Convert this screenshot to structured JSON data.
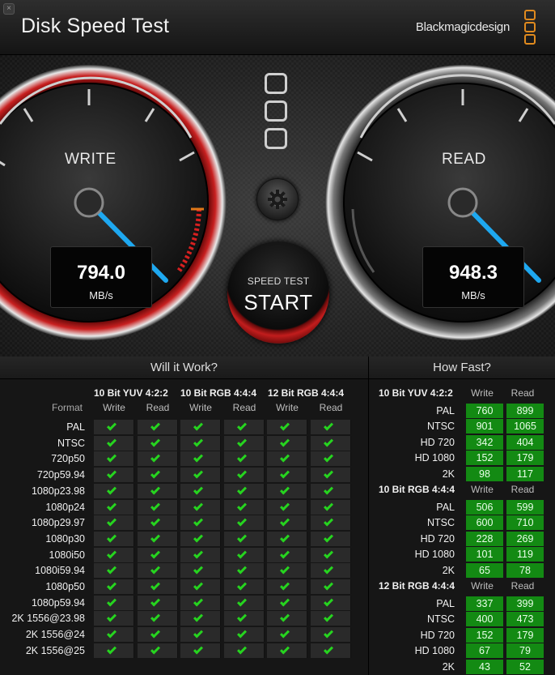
{
  "window": {
    "title": "Disk Speed Test",
    "brand": "Blackmagicdesign",
    "close_glyph": "×"
  },
  "gauges": {
    "write": {
      "label": "WRITE",
      "value": "794.0",
      "unit": "MB/s"
    },
    "read": {
      "label": "READ",
      "value": "948.3",
      "unit": "MB/s"
    }
  },
  "controls": {
    "settings_icon": "gear-icon",
    "start_small": "SPEED TEST",
    "start_big": "START"
  },
  "colors": {
    "accent": "#e08a1e",
    "write_ring": "#c21d1d",
    "needle": "#1ea8f0",
    "check": "#26d41f",
    "speed_cell": "#138a13"
  },
  "will_it_work": {
    "title": "Will it Work?",
    "format_header": "Format",
    "groups": [
      "10 Bit YUV 4:2:2",
      "10 Bit RGB 4:4:4",
      "12 Bit RGB 4:4:4"
    ],
    "sub_headers": [
      "Write",
      "Read",
      "Write",
      "Read",
      "Write",
      "Read"
    ],
    "rows": [
      {
        "format": "PAL",
        "checks": [
          true,
          true,
          true,
          true,
          true,
          true
        ]
      },
      {
        "format": "NTSC",
        "checks": [
          true,
          true,
          true,
          true,
          true,
          true
        ]
      },
      {
        "format": "720p50",
        "checks": [
          true,
          true,
          true,
          true,
          true,
          true
        ]
      },
      {
        "format": "720p59.94",
        "checks": [
          true,
          true,
          true,
          true,
          true,
          true
        ]
      },
      {
        "format": "1080p23.98",
        "checks": [
          true,
          true,
          true,
          true,
          true,
          true
        ]
      },
      {
        "format": "1080p24",
        "checks": [
          true,
          true,
          true,
          true,
          true,
          true
        ]
      },
      {
        "format": "1080p29.97",
        "checks": [
          true,
          true,
          true,
          true,
          true,
          true
        ]
      },
      {
        "format": "1080p30",
        "checks": [
          true,
          true,
          true,
          true,
          true,
          true
        ]
      },
      {
        "format": "1080i50",
        "checks": [
          true,
          true,
          true,
          true,
          true,
          true
        ]
      },
      {
        "format": "1080i59.94",
        "checks": [
          true,
          true,
          true,
          true,
          true,
          true
        ]
      },
      {
        "format": "1080p50",
        "checks": [
          true,
          true,
          true,
          true,
          true,
          true
        ]
      },
      {
        "format": "1080p59.94",
        "checks": [
          true,
          true,
          true,
          true,
          true,
          true
        ]
      },
      {
        "format": "2K 1556@23.98",
        "checks": [
          true,
          true,
          true,
          true,
          true,
          true
        ]
      },
      {
        "format": "2K 1556@24",
        "checks": [
          true,
          true,
          true,
          true,
          true,
          true
        ]
      },
      {
        "format": "2K 1556@25",
        "checks": [
          true,
          true,
          true,
          true,
          true,
          true
        ]
      }
    ]
  },
  "how_fast": {
    "title": "How Fast?",
    "groups": [
      {
        "name": "10 Bit YUV 4:2:2",
        "write_header": "Write",
        "read_header": "Read",
        "rows": [
          {
            "format": "PAL",
            "write": "760",
            "read": "899"
          },
          {
            "format": "NTSC",
            "write": "901",
            "read": "1065"
          },
          {
            "format": "HD 720",
            "write": "342",
            "read": "404"
          },
          {
            "format": "HD 1080",
            "write": "152",
            "read": "179"
          },
          {
            "format": "2K",
            "write": "98",
            "read": "117"
          }
        ]
      },
      {
        "name": "10 Bit RGB 4:4:4",
        "write_header": "Write",
        "read_header": "Read",
        "rows": [
          {
            "format": "PAL",
            "write": "506",
            "read": "599"
          },
          {
            "format": "NTSC",
            "write": "600",
            "read": "710"
          },
          {
            "format": "HD 720",
            "write": "228",
            "read": "269"
          },
          {
            "format": "HD 1080",
            "write": "101",
            "read": "119"
          },
          {
            "format": "2K",
            "write": "65",
            "read": "78"
          }
        ]
      },
      {
        "name": "12 Bit RGB 4:4:4",
        "write_header": "Write",
        "read_header": "Read",
        "rows": [
          {
            "format": "PAL",
            "write": "337",
            "read": "399"
          },
          {
            "format": "NTSC",
            "write": "400",
            "read": "473"
          },
          {
            "format": "HD 720",
            "write": "152",
            "read": "179"
          },
          {
            "format": "HD 1080",
            "write": "67",
            "read": "79"
          },
          {
            "format": "2K",
            "write": "43",
            "read": "52"
          }
        ]
      }
    ]
  }
}
